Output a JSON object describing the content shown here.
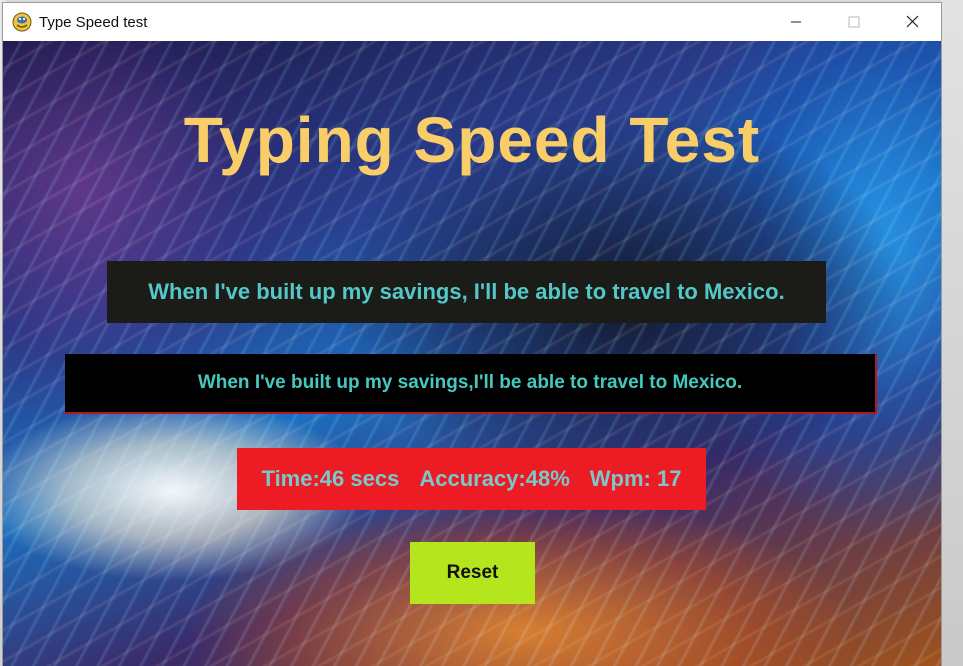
{
  "window": {
    "title": "Type Speed test",
    "app_icon": "python-snake-icon",
    "controls": {
      "minimize": "minimize-icon",
      "maximize": "maximize-icon",
      "close": "close-icon"
    }
  },
  "app": {
    "heading": "Typing Speed Test",
    "target_sentence": "When I've built up my savings, I'll be able to travel to Mexico.",
    "typed_input_value": "When I've built up my savings,I'll be able to travel to Mexico.",
    "results": {
      "time": "Time:46 secs",
      "accuracy": "Accuracy:48%",
      "wpm": "Wpm: 17"
    },
    "reset_label": "Reset"
  },
  "colors": {
    "heading": "#f9cd67",
    "target_box_bg": "#1b1b17",
    "target_text": "#54c8c8",
    "input_bg": "#000000",
    "input_text": "#47c8bd",
    "results_bg": "#ed1c24",
    "results_text": "#79c9cc",
    "reset_bg": "#b5e61d"
  }
}
